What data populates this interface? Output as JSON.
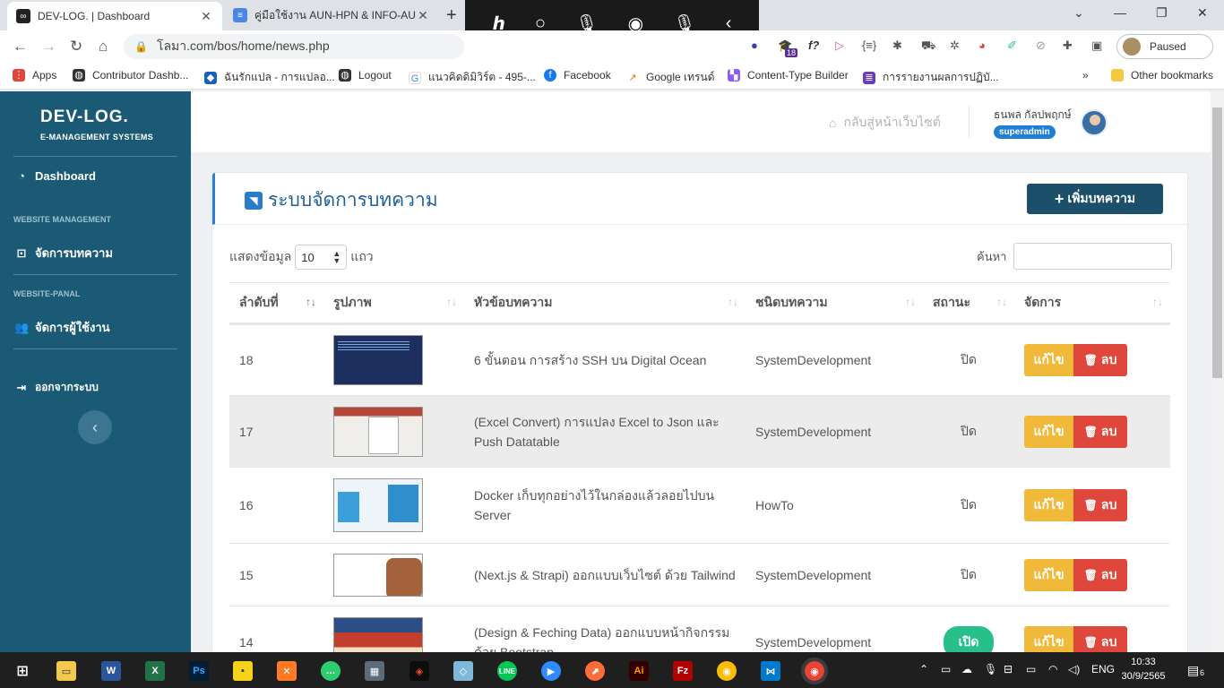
{
  "browser": {
    "tabs": [
      {
        "title": "DEV-LOG. | Dashboard"
      },
      {
        "title": "คู่มือใช้งาน AUN-HPN & INFO-AUN"
      }
    ],
    "url": "โลมา.com/bos/home/news.php",
    "profile": "Paused",
    "bookmarks": [
      {
        "label": "Apps"
      },
      {
        "label": "Contributor Dashb..."
      },
      {
        "label": "ฉันรักแปล - การแปลอ..."
      },
      {
        "label": "Logout"
      },
      {
        "label": "แนวคิดดิมิวิร์ต - 495-..."
      },
      {
        "label": "Facebook"
      },
      {
        "label": "Google เทรนด์"
      },
      {
        "label": "Content-Type Builder"
      },
      {
        "label": "การรายงานผลการปฏิบั..."
      },
      {
        "label": "Other bookmarks"
      }
    ],
    "ext_badge": "18",
    "ext_fx": "f?"
  },
  "sidebar": {
    "brand": "DEV-LOG.",
    "brand_sub": "E-MANAGEMENT SYSTEMS",
    "dashboard": "Dashboard",
    "section1": "WEBSITE MANAGEMENT",
    "manage_articles": "จัดการบทความ",
    "section2": "WEBSITE-PANAL",
    "manage_users": "จัดการผู้ใช้งาน",
    "logout": "ออกจากระบบ"
  },
  "topbar": {
    "home_link": "กลับสู่หน้าเว็บไซต์",
    "user_name": "ธนพล กัลปพฤกษ์",
    "role": "superadmin"
  },
  "card": {
    "title": "ระบบจัดการบทความ",
    "add_button": "เพิ่มบทความ",
    "show_label": "แสดงข้อมูล",
    "page_size": "10",
    "rows_label": "แถว",
    "search_label": "ค้นหา"
  },
  "table": {
    "headers": [
      "ลำดับที่",
      "รูปภาพ",
      "หัวข้อบทความ",
      "ชนิดบทความ",
      "สถานะ",
      "จัดการ"
    ],
    "edit_label": "แก้ไข",
    "delete_label": "ลบ",
    "rows": [
      {
        "no": "18",
        "title": "6 ขั้นตอน การสร้าง SSH บน Digital Ocean",
        "type": "SystemDevelopment",
        "status": "ปิด"
      },
      {
        "no": "17",
        "title": "(Excel Convert) การแปลง Excel to Json และ Push Datatable",
        "type": "SystemDevelopment",
        "status": "ปิด"
      },
      {
        "no": "16",
        "title": "Docker เก็บทุกอย่างไว้ในกล่องแล้วลอยไปบน Server",
        "type": "HowTo",
        "status": "ปิด"
      },
      {
        "no": "15",
        "title": "(Next.js & Strapi) ออกแบบเว็บไซต์ ด้วย Tailwind",
        "type": "SystemDevelopment",
        "status": "ปิด"
      },
      {
        "no": "14",
        "title": "(Design & Feching Data) ออกแบบหน้ากิจกรรม ด้วย Bootstrap",
        "type": "SystemDevelopment",
        "status": "เปิด"
      }
    ]
  },
  "taskbar": {
    "lang": "ENG",
    "time": "10:33",
    "date": "30/9/2565",
    "notif_count": "6"
  }
}
